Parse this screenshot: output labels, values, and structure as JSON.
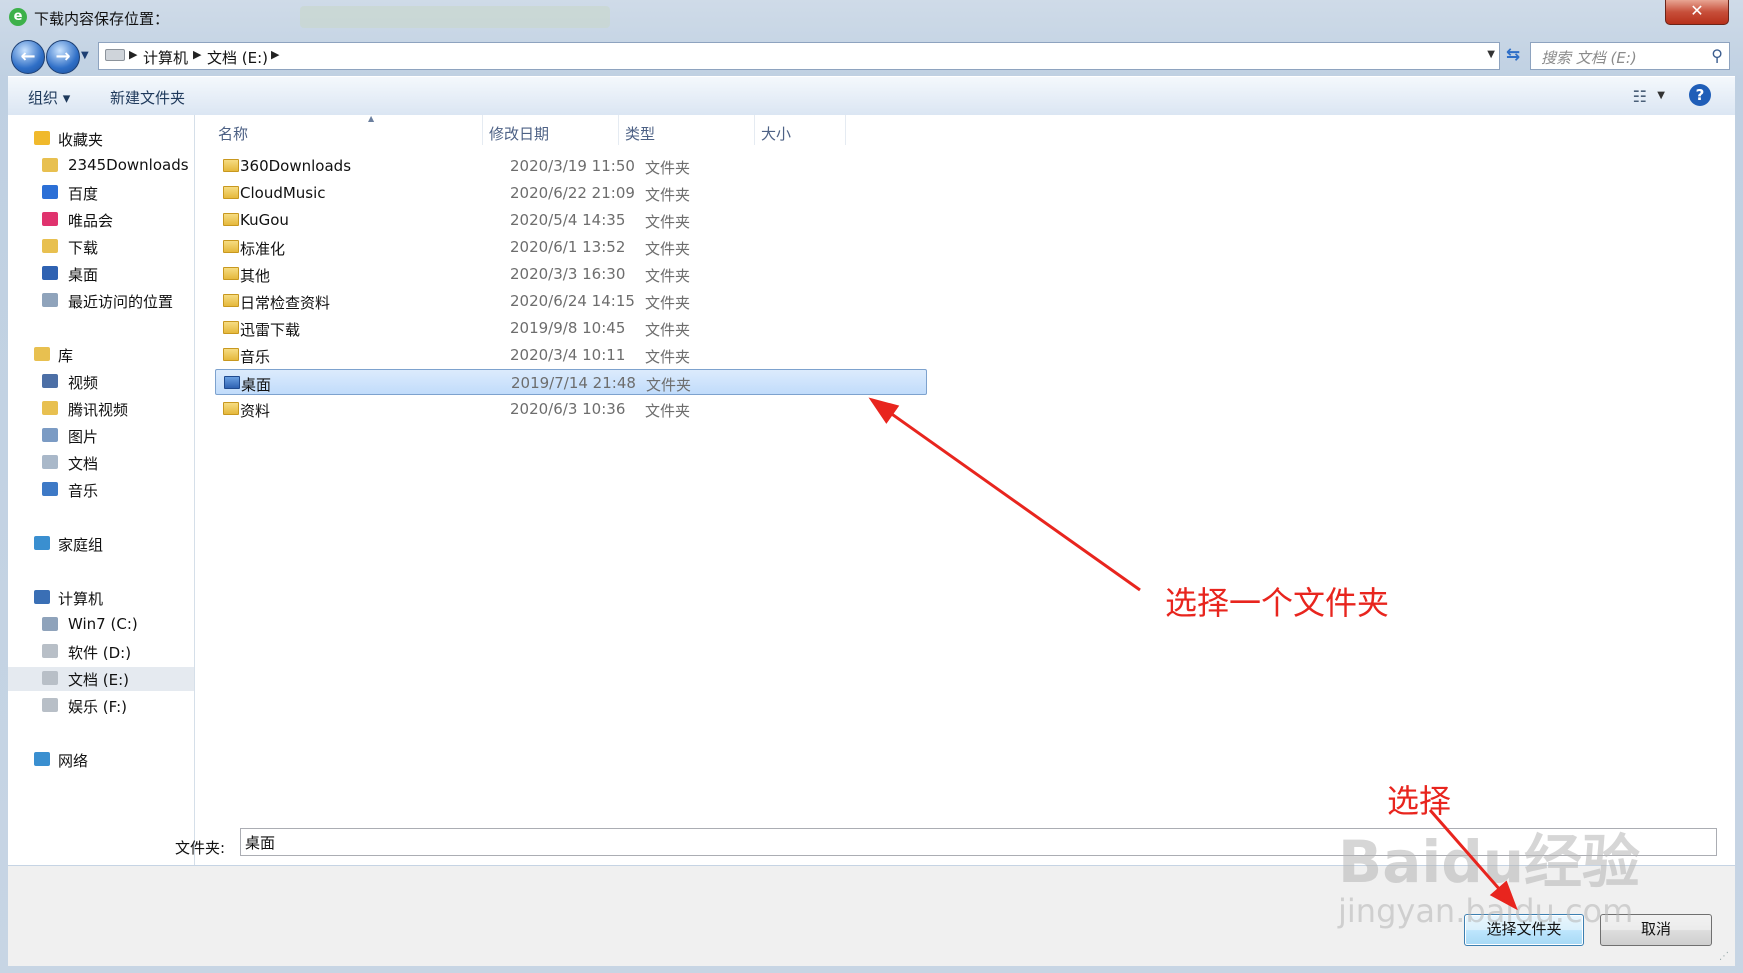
{
  "window": {
    "title": "下载内容保存位置：",
    "app_icon": "e",
    "close_glyph": "✕"
  },
  "nav": {
    "back_glyph": "←",
    "forward_glyph": "→",
    "breadcrumbs": [
      "计算机",
      "文档 (E:)"
    ],
    "refresh_glyph": "⇆",
    "search_placeholder": "搜索 文档 (E:)",
    "search_glyph": "⚲"
  },
  "toolbar": {
    "organize_label": "组织 ▾",
    "new_folder_label": "新建文件夹",
    "help_glyph": "?"
  },
  "sidebar": {
    "groups": [
      {
        "label": "收藏夹",
        "color": "#f0b92c",
        "items": [
          {
            "label": "2345Downloads",
            "color": "#e8c050"
          },
          {
            "label": "百度",
            "color": "#2b6fd6"
          },
          {
            "label": "唯品会",
            "color": "#e0336e"
          },
          {
            "label": "下载",
            "color": "#e8c050"
          },
          {
            "label": "桌面",
            "color": "#2f62b2"
          },
          {
            "label": "最近访问的位置",
            "color": "#8fa3bb"
          }
        ]
      },
      {
        "label": "库",
        "color": "#e8c050",
        "items": [
          {
            "label": "视频",
            "color": "#4c6fa6"
          },
          {
            "label": "腾讯视频",
            "color": "#e8c050"
          },
          {
            "label": "图片",
            "color": "#7b9bc4"
          },
          {
            "label": "文档",
            "color": "#a9b8c9"
          },
          {
            "label": "音乐",
            "color": "#3d79c6"
          }
        ]
      },
      {
        "label": "家庭组",
        "color": "#3a8fd0",
        "items": []
      },
      {
        "label": "计算机",
        "color": "#3a6fb5",
        "items": [
          {
            "label": "Win7 (C:)",
            "color": "#8fa3bb"
          },
          {
            "label": "软件 (D:)",
            "color": "#b8bfc7"
          },
          {
            "label": "文档 (E:)",
            "color": "#b8bfc7",
            "selected": true
          },
          {
            "label": "娱乐 (F:)",
            "color": "#b8bfc7"
          }
        ]
      },
      {
        "label": "网络",
        "color": "#3a8fd0",
        "items": []
      }
    ]
  },
  "columns": {
    "name": "名称",
    "modified": "修改日期",
    "type": "类型",
    "size": "大小"
  },
  "files": [
    {
      "name": "360Downloads",
      "date": "2020/3/19 11:50",
      "type": "文件夹"
    },
    {
      "name": "CloudMusic",
      "date": "2020/6/22 21:09",
      "type": "文件夹"
    },
    {
      "name": "KuGou",
      "date": "2020/5/4 14:35",
      "type": "文件夹"
    },
    {
      "name": "标准化",
      "date": "2020/6/1 13:52",
      "type": "文件夹"
    },
    {
      "name": "其他",
      "date": "2020/3/3 16:30",
      "type": "文件夹"
    },
    {
      "name": "日常检查资料",
      "date": "2020/6/24 14:15",
      "type": "文件夹"
    },
    {
      "name": "迅雷下载",
      "date": "2019/9/8 10:45",
      "type": "文件夹"
    },
    {
      "name": "音乐",
      "date": "2020/3/4 10:11",
      "type": "文件夹"
    },
    {
      "name": "桌面",
      "date": "2019/7/14 21:48",
      "type": "文件夹",
      "selected": true,
      "special": true
    },
    {
      "name": "资料",
      "date": "2020/6/3 10:36",
      "type": "文件夹"
    }
  ],
  "bottom": {
    "folder_label": "文件夹:",
    "folder_value": "桌面",
    "select_button": "选择文件夹",
    "cancel_button": "取消"
  },
  "annotations": {
    "select_folder_text": "选择一个文件夹",
    "select_text": "选择",
    "color": "#e8251e"
  },
  "watermark": {
    "main": "Baidu经验",
    "sub": "jingyan.baidu.com"
  }
}
